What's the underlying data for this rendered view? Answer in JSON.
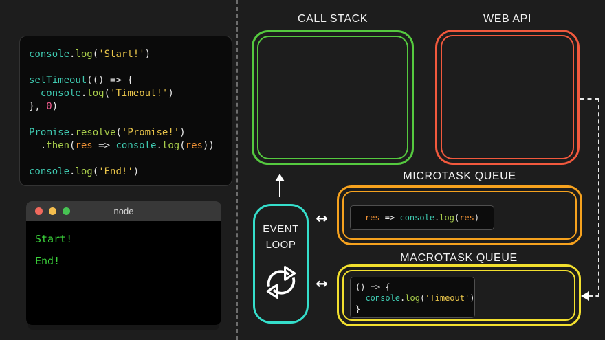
{
  "syntax_colors": {
    "teal": "#3fc9b0",
    "lime": "#a9ce4b",
    "string": "#e8c44a",
    "orange": "#ee9135",
    "pink": "#ee5c8d",
    "plain": "#e8e8e8"
  },
  "code_editor": {
    "lines": [
      [
        [
          "teal",
          "console"
        ],
        [
          "plain",
          "."
        ],
        [
          "lime",
          "log"
        ],
        [
          "plain",
          "("
        ],
        [
          "string",
          "'Start!'"
        ],
        [
          "plain",
          ")"
        ]
      ],
      [],
      [
        [
          "teal",
          "setTimeout"
        ],
        [
          "plain",
          "(() => {"
        ]
      ],
      [
        [
          "plain",
          "  "
        ],
        [
          "teal",
          "console"
        ],
        [
          "plain",
          "."
        ],
        [
          "lime",
          "log"
        ],
        [
          "plain",
          "("
        ],
        [
          "string",
          "'Timeout!'"
        ],
        [
          "plain",
          ")"
        ]
      ],
      [
        [
          "plain",
          "}, "
        ],
        [
          "pink",
          "0"
        ],
        [
          "plain",
          ")"
        ]
      ],
      [],
      [
        [
          "teal",
          "Promise"
        ],
        [
          "plain",
          "."
        ],
        [
          "lime",
          "resolve"
        ],
        [
          "plain",
          "("
        ],
        [
          "string",
          "'Promise!'"
        ],
        [
          "plain",
          ")"
        ]
      ],
      [
        [
          "plain",
          "  ."
        ],
        [
          "lime",
          "then"
        ],
        [
          "plain",
          "("
        ],
        [
          "orange",
          "res"
        ],
        [
          "plain",
          " => "
        ],
        [
          "teal",
          "console"
        ],
        [
          "plain",
          "."
        ],
        [
          "lime",
          "log"
        ],
        [
          "plain",
          "("
        ],
        [
          "orange",
          "res"
        ],
        [
          "plain",
          "))"
        ]
      ],
      [],
      [
        [
          "teal",
          "console"
        ],
        [
          "plain",
          "."
        ],
        [
          "lime",
          "log"
        ],
        [
          "plain",
          "("
        ],
        [
          "string",
          "'End!'"
        ],
        [
          "plain",
          ")"
        ]
      ]
    ]
  },
  "terminal": {
    "title": "node",
    "output_lines": [
      "Start!",
      "End!"
    ],
    "output_color": "#3bd33b",
    "traffic_lights": [
      {
        "name": "close",
        "color": "#f1695d"
      },
      {
        "name": "minimize",
        "color": "#f5be4e"
      },
      {
        "name": "maximize",
        "color": "#47c353"
      }
    ]
  },
  "diagram": {
    "call_stack": {
      "label": "CALL STACK",
      "color": "#55c93f"
    },
    "web_api": {
      "label": "WEB API",
      "color": "#f2593d"
    },
    "event_loop": {
      "line1": "EVENT",
      "line2": "LOOP",
      "color": "#35decb"
    },
    "microtask_queue": {
      "label": "MICROTASK QUEUE",
      "color": "#f6a21e",
      "chip_lines": [
        [
          [
            "orange",
            "res"
          ],
          [
            "plain",
            " => "
          ],
          [
            "teal",
            "console"
          ],
          [
            "plain",
            "."
          ],
          [
            "lime",
            "log"
          ],
          [
            "plain",
            "("
          ],
          [
            "orange",
            "res"
          ],
          [
            "plain",
            ")"
          ]
        ]
      ]
    },
    "macrotask_queue": {
      "label": "MACROTASK QUEUE",
      "color": "#f2df2e",
      "chip_lines": [
        [
          [
            "plain",
            "() => {"
          ]
        ],
        [
          [
            "plain",
            "  "
          ],
          [
            "teal",
            "console"
          ],
          [
            "plain",
            "."
          ],
          [
            "lime",
            "log"
          ],
          [
            "plain",
            "("
          ],
          [
            "string",
            "'Timeout'"
          ],
          [
            "plain",
            ")"
          ]
        ],
        [
          [
            "plain",
            "}"
          ]
        ]
      ]
    },
    "arrows": {
      "bidirectional_glyph": "↔"
    }
  }
}
